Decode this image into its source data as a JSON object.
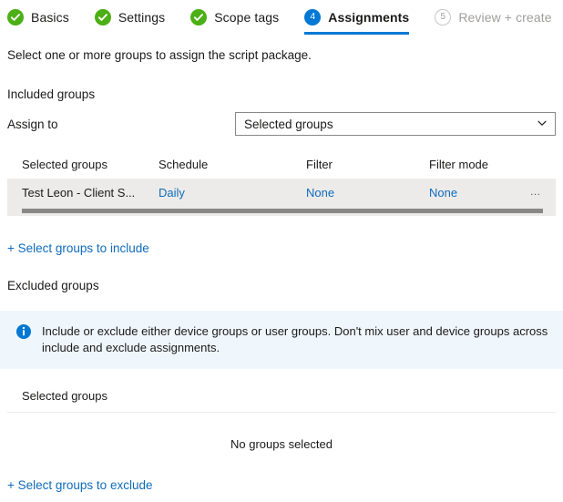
{
  "wizard": {
    "steps": [
      {
        "label": "Basics",
        "state": "complete",
        "icon": "check-circle-icon"
      },
      {
        "label": "Settings",
        "state": "complete",
        "icon": "check-circle-icon"
      },
      {
        "label": "Scope tags",
        "state": "complete",
        "icon": "check-circle-icon"
      },
      {
        "label": "Assignments",
        "state": "current",
        "number": "4"
      },
      {
        "label": "Review + create",
        "state": "pending",
        "number": "5"
      }
    ]
  },
  "page": {
    "intro": "Select one or more groups to assign the script package."
  },
  "included": {
    "section_title": "Included groups",
    "assign_to_label": "Assign to",
    "assign_to_value": "Selected groups",
    "assign_to_options": [
      "Selected groups"
    ],
    "chevron_icon": "chevron-down-icon",
    "columns": [
      "Selected groups",
      "Schedule",
      "Filter",
      "Filter mode"
    ],
    "rows": [
      {
        "group": "Test Leon - Client S...",
        "schedule": "Daily",
        "filter": "None",
        "filter_mode": "None",
        "overflow": "…"
      }
    ],
    "add_link": "+ Select groups to include"
  },
  "excluded": {
    "section_title": "Excluded groups",
    "info_icon": "info-circle-icon",
    "info_text": "Include or exclude either device groups or user groups. Don't mix user and device groups across include and exclude assignments.",
    "column_header": "Selected groups",
    "empty_text": "No groups selected",
    "add_link": "+ Select groups to exclude"
  },
  "colors": {
    "accent": "#0078d4",
    "link": "#0f6cbd",
    "success": "#4caf16",
    "info_bg": "#eff6fc",
    "row_bg": "#edebe9",
    "disabled_text": "#a19f9d"
  }
}
